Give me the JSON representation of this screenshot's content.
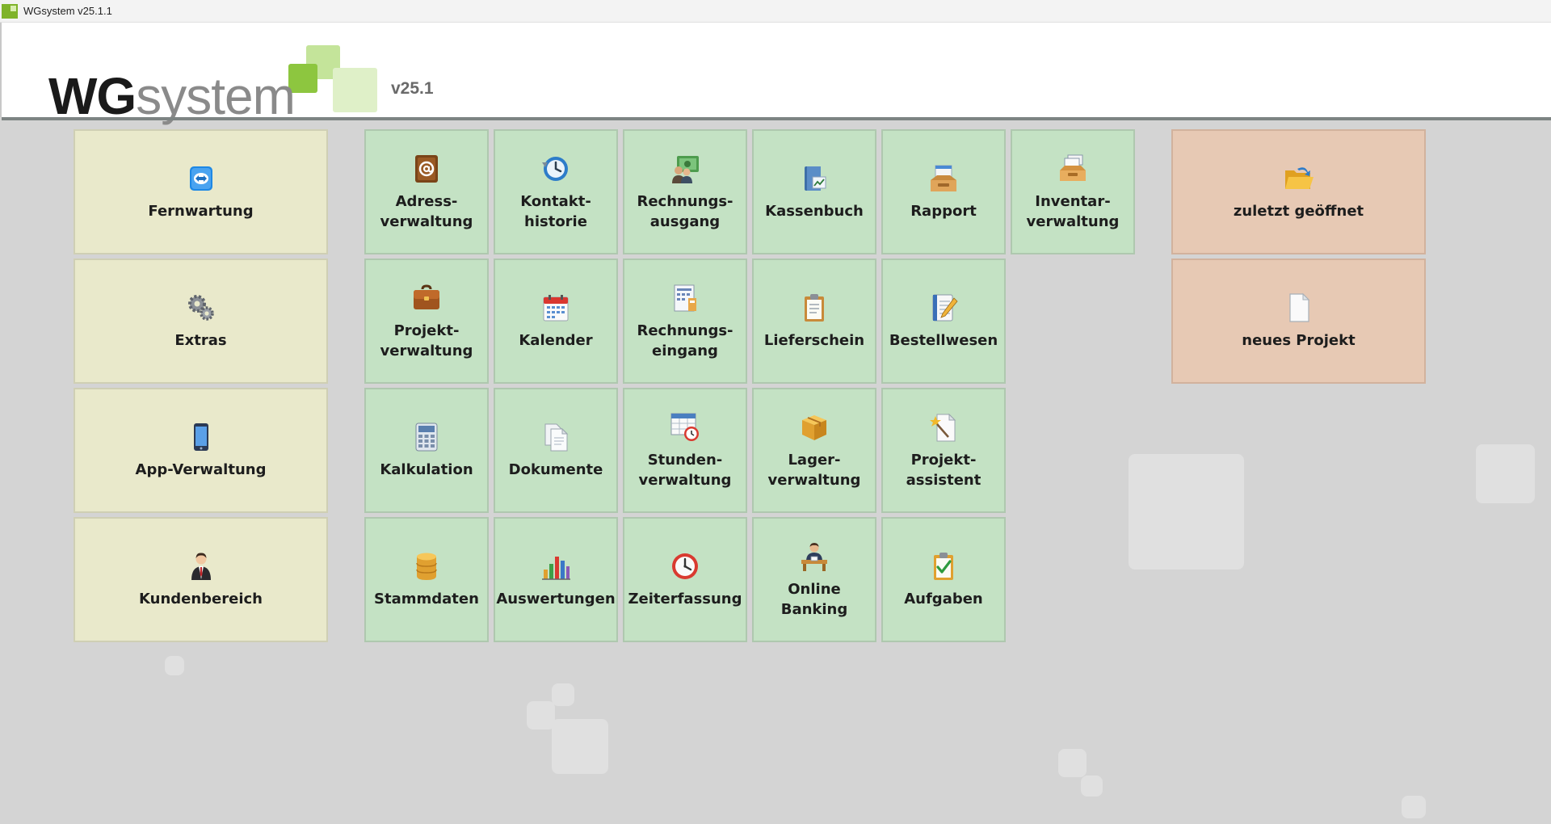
{
  "window": {
    "title": "WGsystem v25.1.1"
  },
  "header": {
    "logo_wg": "WG",
    "logo_system": "system",
    "version": "v25.1"
  },
  "tiles": {
    "fernwartung": {
      "label": "Fernwartung",
      "icon": "teamviewer-icon"
    },
    "extras": {
      "label": "Extras",
      "icon": "gears-icon"
    },
    "app_verwaltung": {
      "label": "App-Verwaltung",
      "icon": "smartphone-icon"
    },
    "kundenbereich": {
      "label": "Kundenbereich",
      "icon": "businessman-icon"
    },
    "adressverwaltung": {
      "label": "Adress-\nverwaltung",
      "icon": "address-book-icon"
    },
    "kontakthistorie": {
      "label": "Kontakt-\nhistorie",
      "icon": "history-icon"
    },
    "rechnungsausgang": {
      "label": "Rechnungs-\nausgang",
      "icon": "money-icon"
    },
    "kassenbuch": {
      "label": "Kassenbuch",
      "icon": "cash-book-icon"
    },
    "rapport": {
      "label": "Rapport",
      "icon": "report-tray-icon"
    },
    "inventarverwaltung": {
      "label": "Inventar-\nverwaltung",
      "icon": "inventory-icon"
    },
    "zuletzt_geoeffnet": {
      "label": "zuletzt geöffnet",
      "icon": "open-folder-icon"
    },
    "projektverwaltung": {
      "label": "Projekt-\nverwaltung",
      "icon": "briefcase-icon"
    },
    "kalender": {
      "label": "Kalender",
      "icon": "calendar-icon"
    },
    "rechnungseingang": {
      "label": "Rechnungs-\neingang",
      "icon": "invoice-calculator-icon"
    },
    "lieferschein": {
      "label": "Lieferschein",
      "icon": "clipboard-icon"
    },
    "bestellwesen": {
      "label": "Bestellwesen",
      "icon": "notepad-pencil-icon"
    },
    "neues_projekt": {
      "label": "neues Projekt",
      "icon": "new-document-icon"
    },
    "kalkulation": {
      "label": "Kalkulation",
      "icon": "calculator-icon"
    },
    "dokumente": {
      "label": "Dokumente",
      "icon": "documents-icon"
    },
    "stundenverwaltung": {
      "label": "Stunden-\nverwaltung",
      "icon": "timesheet-icon"
    },
    "lagerverwaltung": {
      "label": "Lager-\nverwaltung",
      "icon": "box-icon"
    },
    "projektassistent": {
      "label": "Projekt-\nassistent",
      "icon": "wizard-icon"
    },
    "stammdaten": {
      "label": "Stammdaten",
      "icon": "database-icon"
    },
    "auswertungen": {
      "label": "Auswertungen",
      "icon": "bar-chart-icon"
    },
    "zeiterfassung": {
      "label": "Zeiterfassung",
      "icon": "clock-icon"
    },
    "online_banking": {
      "label": "Online\nBanking",
      "icon": "banker-icon"
    },
    "aufgaben": {
      "label": "Aufgaben",
      "icon": "task-check-icon"
    }
  }
}
